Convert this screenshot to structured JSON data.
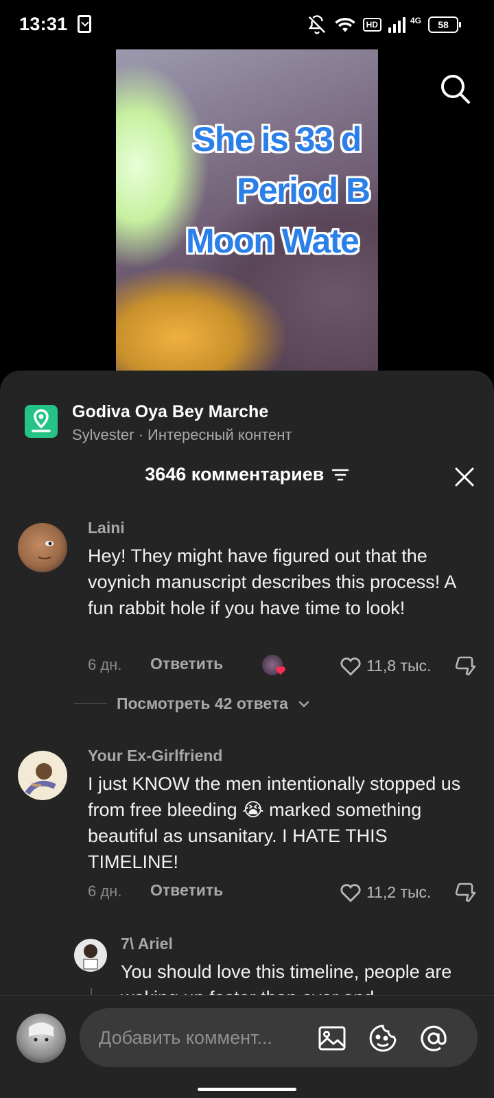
{
  "status": {
    "time": "13:31",
    "hd": "HD",
    "network": "4G",
    "battery": "58"
  },
  "video": {
    "overlay_lines": [
      "She is 33 d",
      "Period B",
      "Moon Wate"
    ]
  },
  "place": {
    "name": "Godiva Oya Bey Marche",
    "subtitle": "Sylvester · Интересный контент"
  },
  "comments_header": {
    "count_label": "3646 комментариев"
  },
  "comments": [
    {
      "user": "Laini",
      "text": "Hey! They might have figured out that the voynich manuscript describes this process! A fun rabbit hole if you have time to look!",
      "age": "6 дн.",
      "reply_label": "Ответить",
      "likes": "11,8 тыс."
    },
    {
      "user": "Your Ex-Girlfriend",
      "text": "I just KNOW the men intentionally stopped us from free bleeding 😭 marked something beautiful as unsanitary. I HATE THIS TIMELINE!",
      "age": "6 дн.",
      "reply_label": "Ответить",
      "likes": "11,2 тыс."
    }
  ],
  "view_replies": "Посмотреть 42 ответа",
  "reply": {
    "user": "7\\ Ariel",
    "text": "You should love this timeline, people are waking up faster than ever and"
  },
  "composer": {
    "placeholder": "Добавить коммент..."
  }
}
